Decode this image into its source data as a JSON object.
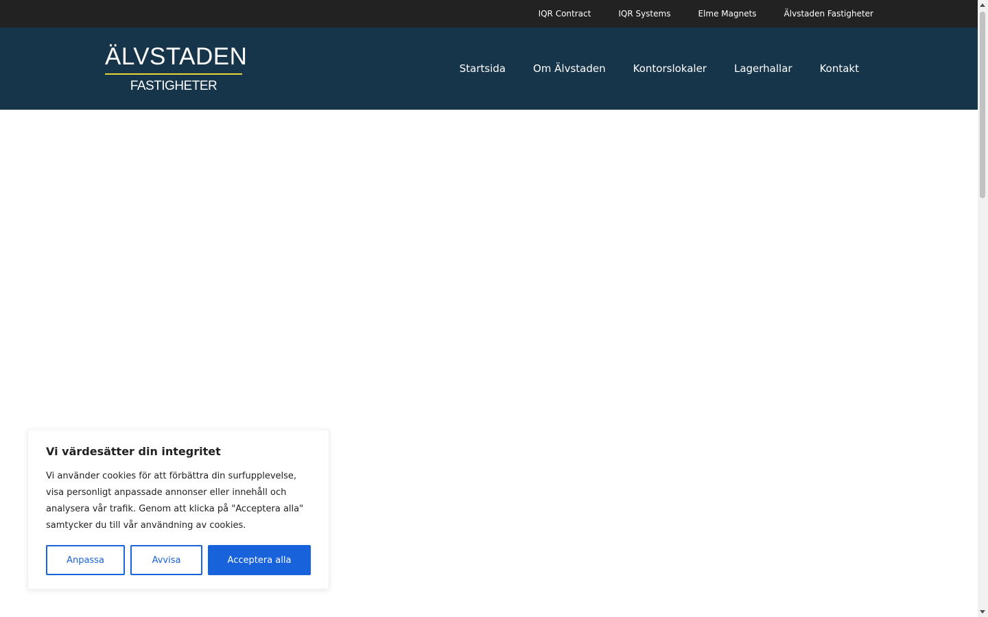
{
  "topbar": {
    "links": [
      "IQR Contract",
      "IQR Systems",
      "Elme Magnets",
      "Älvstaden Fastigheter"
    ]
  },
  "logo": {
    "title": "ÄLVSTADEN",
    "subtitle": "FASTIGHETER",
    "accent_color": "#e8d637"
  },
  "nav": {
    "items": [
      "Startsida",
      "Om Älvstaden",
      "Kontorslokaler",
      "Lagerhallar",
      "Kontakt"
    ]
  },
  "cookie": {
    "title": "Vi värdesätter din integritet",
    "text": "Vi använder cookies för att förbättra din surfupplevelse, visa personligt anpassade annonser eller innehåll och analysera vår trafik. Genom att klicka på \"Acceptera alla\" samtycker du till vår användning av cookies.",
    "customize_label": "Anpassa",
    "reject_label": "Avvisa",
    "accept_label": "Acceptera alla"
  },
  "colors": {
    "topbar": "#222222",
    "header": "#16344a",
    "button_blue": "#1863dc"
  }
}
